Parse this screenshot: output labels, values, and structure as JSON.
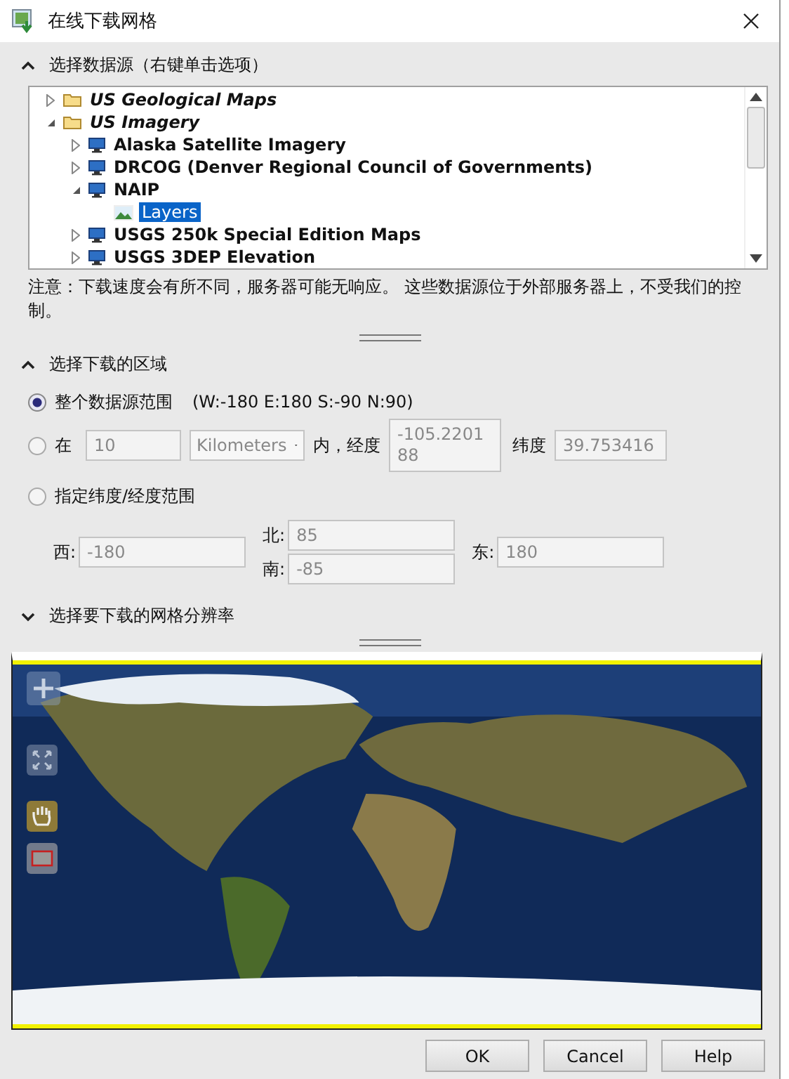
{
  "window": {
    "title": "在线下载网格"
  },
  "source_section": {
    "title": "选择数据源（右键单击选项）",
    "expanded": true,
    "tree": [
      {
        "label": "US Geological Maps",
        "kind": "folder",
        "expanded": false,
        "selected": false
      },
      {
        "label": "US Imagery",
        "kind": "folder",
        "expanded": true,
        "selected": false,
        "children": [
          {
            "label": "Alaska Satellite Imagery",
            "kind": "service",
            "expanded": false,
            "selected": false
          },
          {
            "label": "DRCOG (Denver Regional Council of Governments)",
            "kind": "service",
            "expanded": false,
            "selected": false
          },
          {
            "label": "NAIP",
            "kind": "service",
            "expanded": true,
            "selected": false,
            "children": [
              {
                "label": "Layers",
                "kind": "layer",
                "selected": true
              }
            ]
          },
          {
            "label": "USGS 250k Special Edition Maps",
            "kind": "service",
            "expanded": false,
            "selected": false
          },
          {
            "label": "USGS 3DEP Elevation",
            "kind": "service",
            "expanded": false,
            "selected": false
          }
        ]
      }
    ],
    "note": "注意：下载速度会有所不同，服务器可能无响应。 这些数据源位于外部服务器上，不受我们的控制。"
  },
  "area_section": {
    "title": "选择下载的区域",
    "expanded": true,
    "options": [
      {
        "kind": "whole",
        "label": "整个数据源范围",
        "extent": "(W:-180 E:180 S:-90 N:90)",
        "selected": true
      },
      {
        "kind": "radius",
        "label": "在",
        "distance": "10",
        "unit": "Kilometers",
        "within": "内，经度",
        "longitude": "-105.220188",
        "latitude_label": "纬度",
        "latitude": "39.753416",
        "selected": false
      },
      {
        "kind": "bounds",
        "label": "指定纬度/经度范围",
        "selected": false,
        "west_label": "西:",
        "west": "-180",
        "north_label": "北:",
        "north": "85",
        "south_label": "南:",
        "south": "-85",
        "east_label": "东:",
        "east": "180"
      }
    ]
  },
  "resolution_section": {
    "title": "选择要下载的网格分辨率",
    "expanded": false
  },
  "map": {
    "hand_tool_selected": true
  },
  "buttons": [
    "OK",
    "Cancel",
    "Help"
  ]
}
